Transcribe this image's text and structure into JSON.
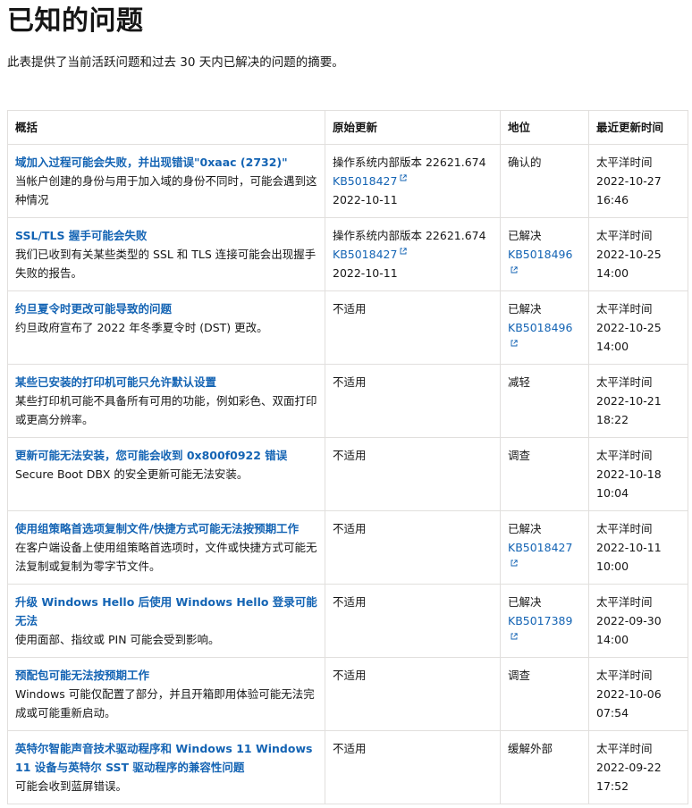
{
  "page": {
    "title": "已知的问题",
    "description": "此表提供了当前活跃问题和过去 30 天内已解决的问题的摘要。"
  },
  "table": {
    "headers": [
      "概括",
      "原始更新",
      "地位",
      "最近更新时间"
    ],
    "rows": [
      {
        "title": "域加入过程可能会失败，并出现错误\"0xaac (2732)\"",
        "summary": "当帐户创建的身份与用于加入域的身份不同时，可能会遇到这种情况",
        "origin_text": "操作系统内部版本 22621.674",
        "origin_kb": "KB5018427",
        "origin_date": "2022-10-11",
        "status": "确认的",
        "status_kb": "",
        "updated_tz": "太平洋时间",
        "updated_date": "2022-10-27",
        "updated_time": "16:46"
      },
      {
        "title": "SSL/TLS 握手可能会失败",
        "summary": "我们已收到有关某些类型的 SSL 和 TLS 连接可能会出现握手失败的报告。",
        "origin_text": "操作系统内部版本 22621.674",
        "origin_kb": "KB5018427",
        "origin_date": "2022-10-11",
        "status": "已解决",
        "status_kb": "KB5018496",
        "updated_tz": "太平洋时间",
        "updated_date": "2022-10-25",
        "updated_time": "14:00"
      },
      {
        "title": "约旦夏令时更改可能导致的问题",
        "summary": "约旦政府宣布了 2022 年冬季夏令时 (DST) 更改。",
        "origin_text": "不适用",
        "origin_kb": "",
        "origin_date": "",
        "status": "已解决",
        "status_kb": "KB5018496",
        "updated_tz": "太平洋时间",
        "updated_date": "2022-10-25",
        "updated_time": "14:00"
      },
      {
        "title": "某些已安装的打印机可能只允许默认设置",
        "summary": "某些打印机可能不具备所有可用的功能，例如彩色、双面打印或更高分辨率。",
        "origin_text": "不适用",
        "origin_kb": "",
        "origin_date": "",
        "status": "减轻",
        "status_kb": "",
        "updated_tz": "太平洋时间",
        "updated_date": "2022-10-21",
        "updated_time": "18:22"
      },
      {
        "title": "更新可能无法安装，您可能会收到 0x800f0922 错误",
        "summary": "Secure Boot DBX 的安全更新可能无法安装。",
        "origin_text": "不适用",
        "origin_kb": "",
        "origin_date": "",
        "status": "调查",
        "status_kb": "",
        "updated_tz": "太平洋时间",
        "updated_date": "2022-10-18",
        "updated_time": "10:04"
      },
      {
        "title": "使用组策略首选项复制文件/快捷方式可能无法按预期工作",
        "summary": "在客户端设备上使用组策略首选项时，文件或快捷方式可能无法复制或复制为零字节文件。",
        "origin_text": "不适用",
        "origin_kb": "",
        "origin_date": "",
        "status": "已解决",
        "status_kb": "KB5018427",
        "updated_tz": "太平洋时间",
        "updated_date": "2022-10-11",
        "updated_time": "10:00"
      },
      {
        "title": "升级 Windows Hello 后使用 Windows Hello 登录可能无法",
        "summary": "使用面部、指纹或 PIN 可能会受到影响。",
        "origin_text": "不适用",
        "origin_kb": "",
        "origin_date": "",
        "status": "已解决",
        "status_kb": "KB5017389",
        "updated_tz": "太平洋时间",
        "updated_date": "2022-09-30",
        "updated_time": "14:00"
      },
      {
        "title": "预配包可能无法按预期工作",
        "summary": "Windows 可能仅配置了部分，并且开箱即用体验可能无法完成或可能重新启动。",
        "origin_text": "不适用",
        "origin_kb": "",
        "origin_date": "",
        "status": "调查",
        "status_kb": "",
        "updated_tz": "太平洋时间",
        "updated_date": "2022-10-06",
        "updated_time": "07:54"
      },
      {
        "title": "英特尔智能声音技术驱动程序和 Windows 11 Windows 11 设备与英特尔 SST 驱动程序的兼容性问题",
        "summary": "可能会收到蓝屏错误。",
        "origin_text": "不适用",
        "origin_kb": "",
        "origin_date": "",
        "status": "缓解外部",
        "status_kb": "",
        "updated_tz": "太平洋时间",
        "updated_date": "2022-09-22",
        "updated_time": "17:52"
      }
    ]
  },
  "icons": {
    "kb_link": "external-link-icon"
  },
  "colors": {
    "link": "#1464b4",
    "border": "#e1dfdd",
    "text": "#161616"
  }
}
